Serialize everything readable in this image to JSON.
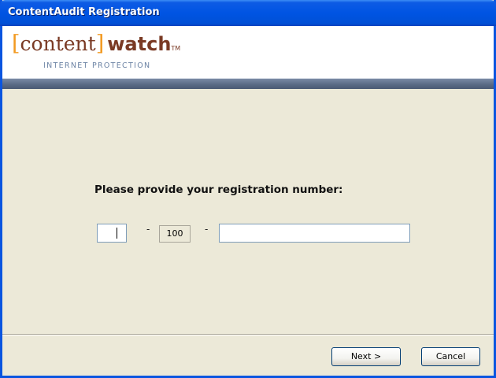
{
  "window": {
    "title": "ContentAudit Registration"
  },
  "logo": {
    "bracket_open": "[",
    "content": "content",
    "bracket_close": "]",
    "watch": "watch",
    "tm": "TM",
    "tagline": "INTERNET PROTECTION"
  },
  "form": {
    "prompt": "Please provide your registration number:",
    "part1_value": "",
    "separator": "-",
    "part2_value": "100",
    "part3_value": ""
  },
  "buttons": {
    "next_label": "Next >",
    "cancel_label": "Cancel"
  },
  "colors": {
    "titlebar": "#0054e3",
    "background": "#ece9d8",
    "logo_bracket": "#f29a22",
    "logo_text": "#7a3a24",
    "tagline": "#6d84a5",
    "header_bar": "#586983"
  }
}
